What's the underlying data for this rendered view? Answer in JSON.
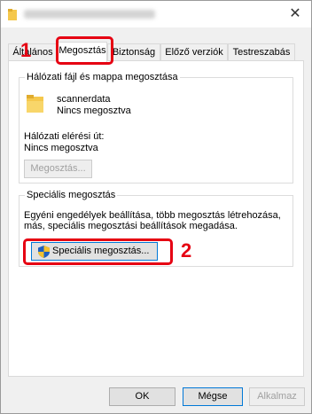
{
  "tabs": [
    {
      "label": "Általános"
    },
    {
      "label": "Megosztás"
    },
    {
      "label": "Biztonság"
    },
    {
      "label": "Előző verziók"
    },
    {
      "label": "Testreszabás"
    }
  ],
  "network_share": {
    "group_title": "Hálózati fájl és mappa megosztása",
    "folder_name": "scannerdata",
    "share_status": "Nincs megosztva",
    "path_label": "Hálózati elérési út:",
    "path_value": "Nincs megosztva",
    "share_button": "Megosztás..."
  },
  "advanced_share": {
    "group_title": "Speciális megosztás",
    "description_line1": "Egyéni engedélyek beállítása, több megosztás létrehozása,",
    "description_line2": "más, speciális megosztási beállítások megadása.",
    "button_label": "Speciális megosztás..."
  },
  "footer": {
    "ok": "OK",
    "cancel": "Mégse",
    "apply": "Alkalmaz"
  },
  "callouts": {
    "step1": "1",
    "step2": "2"
  },
  "colors": {
    "callout": "#e60012",
    "folder": "#f5c84c",
    "shield_blue": "#1f5fbf",
    "shield_yellow": "#f2c12e"
  }
}
